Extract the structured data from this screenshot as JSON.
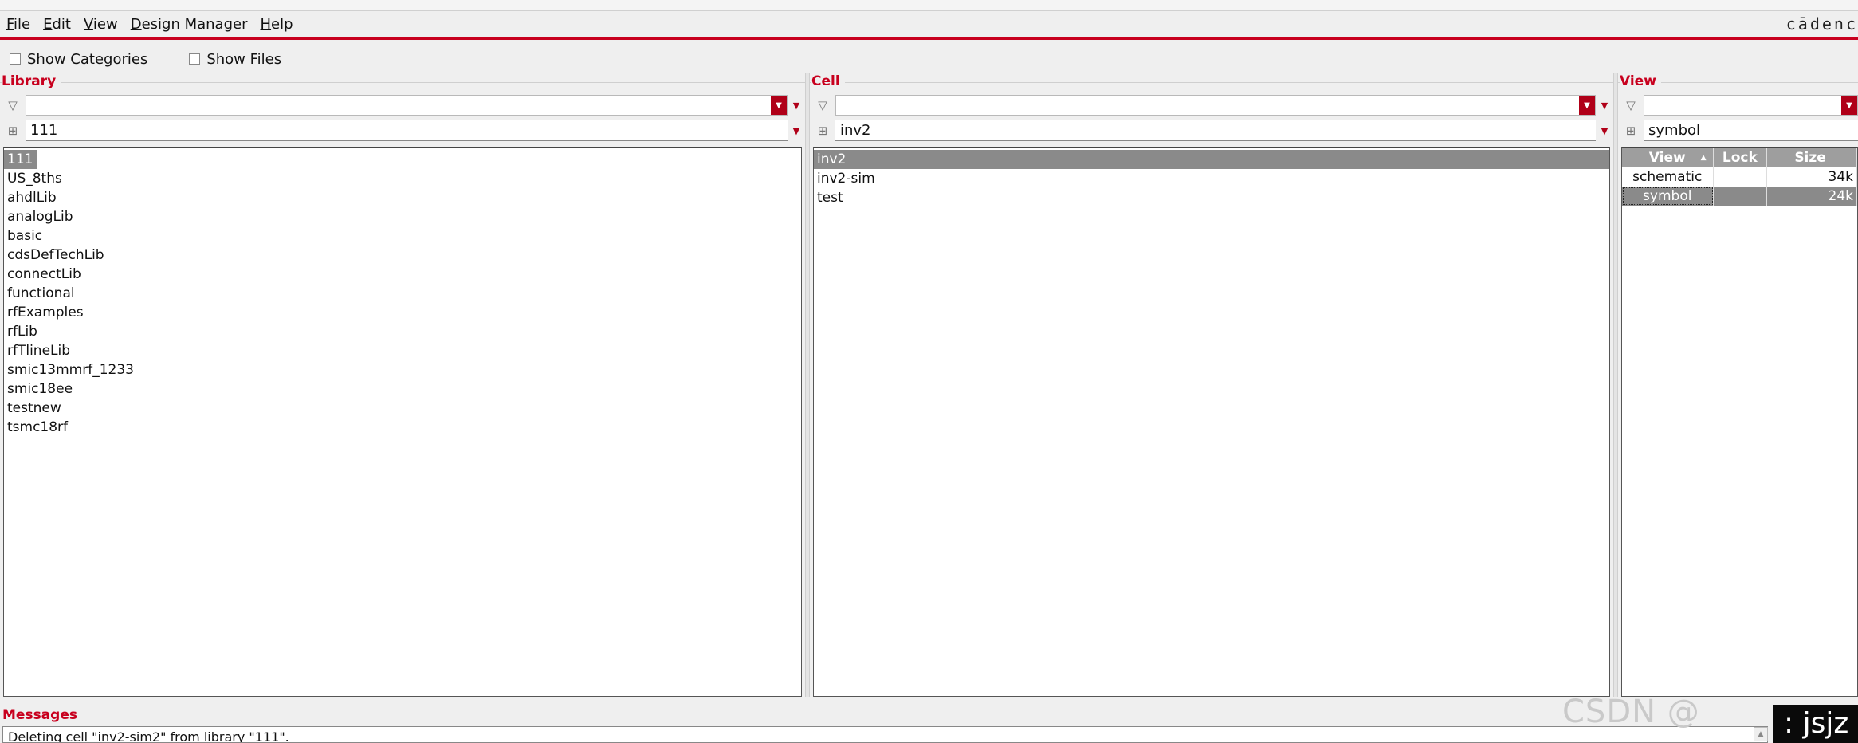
{
  "menubar": {
    "items": [
      {
        "label": "File",
        "u": "F",
        "rest": "ile"
      },
      {
        "label": "Edit",
        "u": "E",
        "rest": "dit"
      },
      {
        "label": "View",
        "u": "V",
        "rest": "iew"
      },
      {
        "label": "Design Manager",
        "u": "D",
        "rest": "esign Manager"
      },
      {
        "label": "Help",
        "u": "H",
        "rest": "elp"
      }
    ],
    "brand": "cādenc"
  },
  "toolbar": {
    "show_categories": "Show Categories",
    "show_files": "Show Files"
  },
  "library": {
    "title": "Library",
    "filter_value": "",
    "name_value": "111",
    "items": [
      "111",
      "US_8ths",
      "ahdlLib",
      "analogLib",
      "basic",
      "cdsDefTechLib",
      "connectLib",
      "functional",
      "rfExamples",
      "rfLib",
      "rfTlineLib",
      "smic13mmrf_1233",
      "smic18ee",
      "testnew",
      "tsmc18rf"
    ],
    "selected": "111"
  },
  "cell": {
    "title": "Cell",
    "filter_value": "",
    "name_value": "inv2",
    "items": [
      "inv2",
      "inv2-sim",
      "test"
    ],
    "selected": "inv2"
  },
  "view": {
    "title": "View",
    "filter_value": "",
    "name_value": "symbol",
    "columns": {
      "view": "View",
      "lock": "Lock",
      "size": "Size"
    },
    "rows": [
      {
        "view": "schematic",
        "lock": "",
        "size": "34k",
        "selected": false
      },
      {
        "view": "symbol",
        "lock": "",
        "size": "24k",
        "selected": true
      }
    ]
  },
  "messages": {
    "title": "Messages",
    "text": "Deleting cell \"inv2-sim2\" from library \"111\"."
  },
  "overlay": {
    "watermark": "CSDN @",
    "corner_text": ": jsjz"
  },
  "colors": {
    "accent": "#c8001e",
    "selection": "#8a8a8a"
  }
}
